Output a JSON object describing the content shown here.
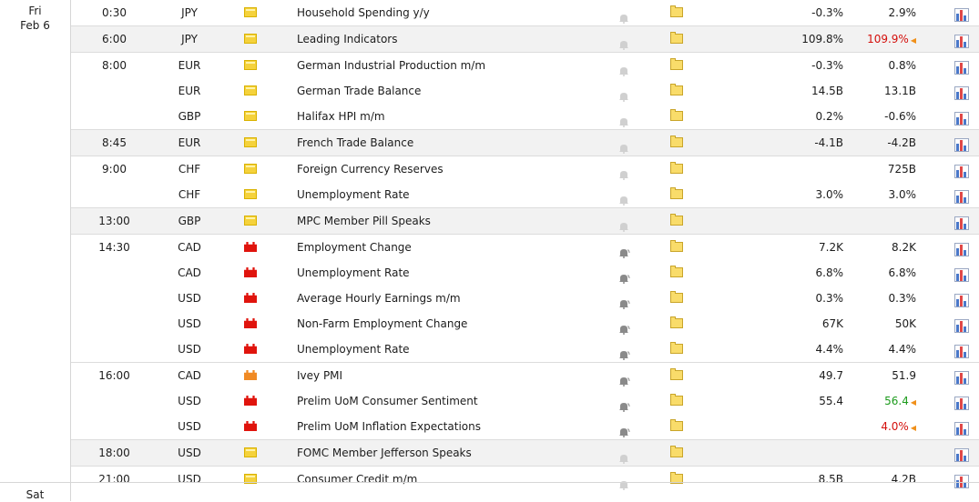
{
  "days": [
    {
      "weekday": "Fri",
      "date": "Feb 6"
    },
    {
      "weekday": "Sat",
      "date": ""
    }
  ],
  "colors": {
    "low": "#f5d23c",
    "medium": "#f08a24",
    "high": "#e0140d",
    "revised_up": "#1d9b1d",
    "revised_down": "#d4100c"
  },
  "events": [
    {
      "time": "0:30",
      "currency": "JPY",
      "impact": "low",
      "event": "Household Spending y/y",
      "actual": "-0.3%",
      "forecast": "2.9%",
      "forecast_color": "",
      "revised": false,
      "alert": false,
      "shade": false,
      "group_start": true
    },
    {
      "time": "6:00",
      "currency": "JPY",
      "impact": "low",
      "event": "Leading Indicators",
      "actual": "109.8%",
      "forecast": "109.9%",
      "forecast_color": "red",
      "revised": true,
      "alert": false,
      "shade": true,
      "group_start": true
    },
    {
      "time": "8:00",
      "currency": "EUR",
      "impact": "low",
      "event": "German Industrial Production m/m",
      "actual": "-0.3%",
      "forecast": "0.8%",
      "forecast_color": "",
      "revised": false,
      "alert": false,
      "shade": false,
      "group_start": true
    },
    {
      "time": "",
      "currency": "EUR",
      "impact": "low",
      "event": "German Trade Balance",
      "actual": "14.5B",
      "forecast": "13.1B",
      "forecast_color": "",
      "revised": false,
      "alert": false,
      "shade": false,
      "group_start": false
    },
    {
      "time": "",
      "currency": "GBP",
      "impact": "low",
      "event": "Halifax HPI m/m",
      "actual": "0.2%",
      "forecast": "-0.6%",
      "forecast_color": "",
      "revised": false,
      "alert": false,
      "shade": false,
      "group_start": false
    },
    {
      "time": "8:45",
      "currency": "EUR",
      "impact": "low",
      "event": "French Trade Balance",
      "actual": "-4.1B",
      "forecast": "-4.2B",
      "forecast_color": "",
      "revised": false,
      "alert": false,
      "shade": true,
      "group_start": true
    },
    {
      "time": "9:00",
      "currency": "CHF",
      "impact": "low",
      "event": "Foreign Currency Reserves",
      "actual": "",
      "forecast": "725B",
      "forecast_color": "",
      "revised": false,
      "alert": false,
      "shade": false,
      "group_start": true
    },
    {
      "time": "",
      "currency": "CHF",
      "impact": "low",
      "event": "Unemployment Rate",
      "actual": "3.0%",
      "forecast": "3.0%",
      "forecast_color": "",
      "revised": false,
      "alert": false,
      "shade": false,
      "group_start": false
    },
    {
      "time": "13:00",
      "currency": "GBP",
      "impact": "low",
      "event": "MPC Member Pill Speaks",
      "actual": "",
      "forecast": "",
      "forecast_color": "",
      "revised": false,
      "alert": false,
      "shade": true,
      "group_start": true
    },
    {
      "time": "14:30",
      "currency": "CAD",
      "impact": "high",
      "event": "Employment Change",
      "actual": "7.2K",
      "forecast": "8.2K",
      "forecast_color": "",
      "revised": false,
      "alert": true,
      "shade": false,
      "group_start": true
    },
    {
      "time": "",
      "currency": "CAD",
      "impact": "high",
      "event": "Unemployment Rate",
      "actual": "6.8%",
      "forecast": "6.8%",
      "forecast_color": "",
      "revised": false,
      "alert": true,
      "shade": false,
      "group_start": false
    },
    {
      "time": "",
      "currency": "USD",
      "impact": "high",
      "event": "Average Hourly Earnings m/m",
      "actual": "0.3%",
      "forecast": "0.3%",
      "forecast_color": "",
      "revised": false,
      "alert": true,
      "shade": false,
      "group_start": false
    },
    {
      "time": "",
      "currency": "USD",
      "impact": "high",
      "event": "Non-Farm Employment Change",
      "actual": "67K",
      "forecast": "50K",
      "forecast_color": "",
      "revised": false,
      "alert": true,
      "shade": false,
      "group_start": false
    },
    {
      "time": "",
      "currency": "USD",
      "impact": "high",
      "event": "Unemployment Rate",
      "actual": "4.4%",
      "forecast": "4.4%",
      "forecast_color": "",
      "revised": false,
      "alert": true,
      "shade": false,
      "group_start": false
    },
    {
      "time": "16:00",
      "currency": "CAD",
      "impact": "medium",
      "event": "Ivey PMI",
      "actual": "49.7",
      "forecast": "51.9",
      "forecast_color": "",
      "revised": false,
      "alert": true,
      "shade": false,
      "group_start": true
    },
    {
      "time": "",
      "currency": "USD",
      "impact": "high",
      "event": "Prelim UoM Consumer Sentiment",
      "actual": "55.4",
      "forecast": "56.4",
      "forecast_color": "green",
      "revised": true,
      "alert": true,
      "shade": false,
      "group_start": false
    },
    {
      "time": "",
      "currency": "USD",
      "impact": "high",
      "event": "Prelim UoM Inflation Expectations",
      "actual": "",
      "forecast": "4.0%",
      "forecast_color": "red",
      "revised": true,
      "alert": true,
      "shade": false,
      "group_start": false
    },
    {
      "time": "18:00",
      "currency": "USD",
      "impact": "low",
      "event": "FOMC Member Jefferson Speaks",
      "actual": "",
      "forecast": "",
      "forecast_color": "",
      "revised": false,
      "alert": false,
      "shade": true,
      "group_start": true
    },
    {
      "time": "21:00",
      "currency": "USD",
      "impact": "low",
      "event": "Consumer Credit m/m",
      "actual": "8.5B",
      "forecast": "4.2B",
      "forecast_color": "",
      "revised": false,
      "alert": false,
      "shade": false,
      "group_start": true
    }
  ]
}
